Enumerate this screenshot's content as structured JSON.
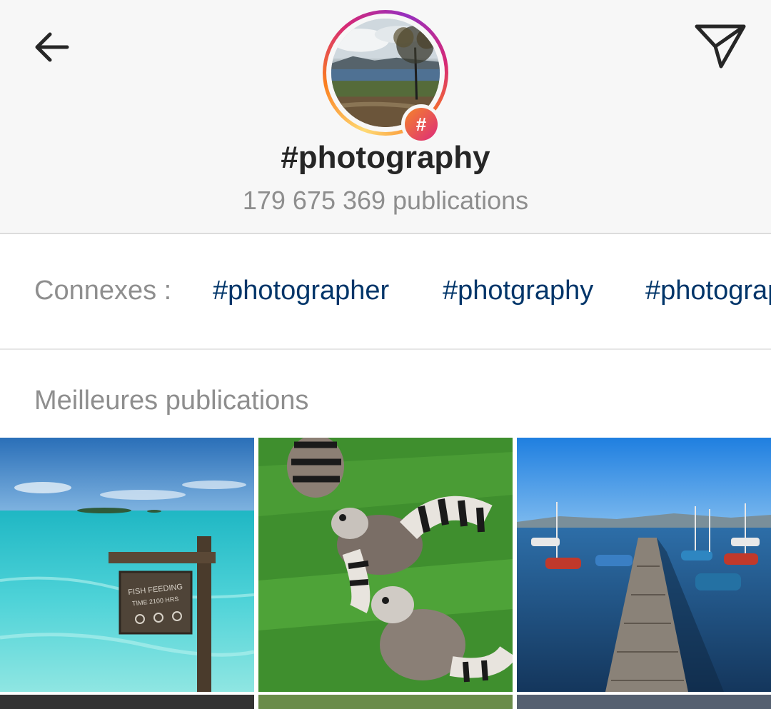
{
  "header": {
    "tag_title": "#photography",
    "post_count": "179 675 369 publications",
    "hash_symbol": "#"
  },
  "related": {
    "label": "Connexes :",
    "tags": [
      "#photographer",
      "#photgraphy",
      "#photography"
    ]
  },
  "top_posts": {
    "title": "Meilleures publications",
    "tiles": [
      "maldives-lagoon-sign",
      "ring-tailed-lemurs",
      "harbor-pier-boats"
    ],
    "sign_text": "FISH FEEDING TIME 2100 HRS"
  },
  "colors": {
    "link": "#003569",
    "secondary_text": "#8e8e8e",
    "primary_text": "#262626"
  },
  "icons": {
    "back": "arrow-left-icon",
    "share": "paper-plane-icon",
    "hashtag": "hashtag-icon"
  }
}
